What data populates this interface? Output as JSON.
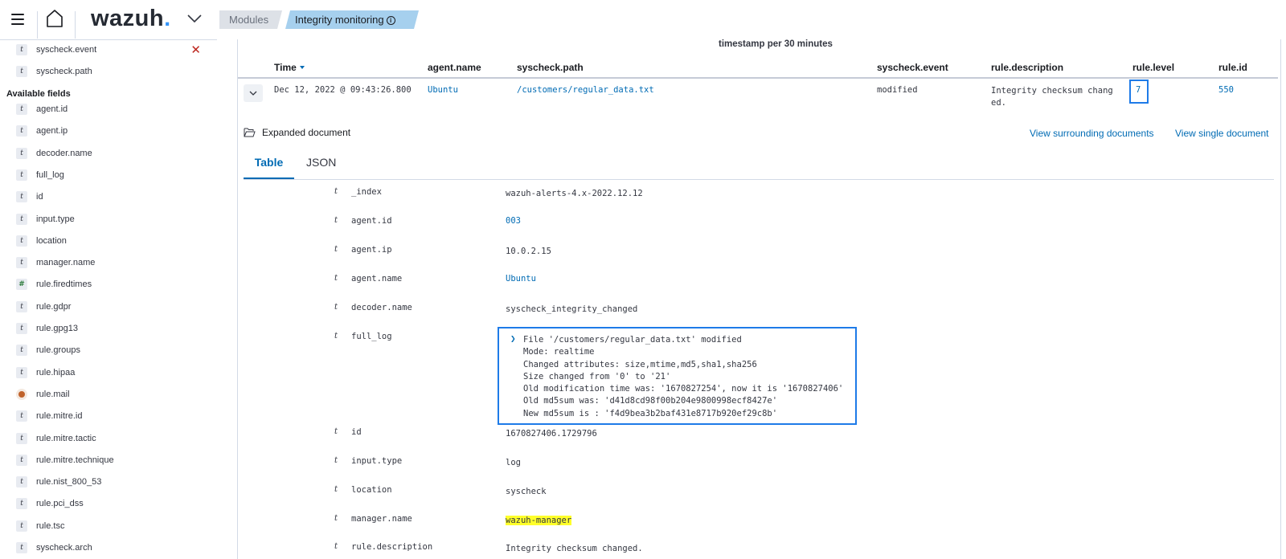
{
  "header": {
    "logo_text": "wazuh",
    "logo_dot": ".",
    "breadcrumb_modules": "Modules",
    "breadcrumb_active": "Integrity monitoring",
    "info_glyph": "i"
  },
  "sidebar": {
    "selected_fields": [
      {
        "type": "t",
        "name": "syscheck.event",
        "removable": true
      },
      {
        "type": "t",
        "name": "syscheck.path"
      }
    ],
    "available_label": "Available fields",
    "available_fields": [
      {
        "type": "t",
        "name": "agent.id"
      },
      {
        "type": "t",
        "name": "agent.ip"
      },
      {
        "type": "t",
        "name": "decoder.name"
      },
      {
        "type": "t",
        "name": "full_log"
      },
      {
        "type": "t",
        "name": "id"
      },
      {
        "type": "t",
        "name": "input.type"
      },
      {
        "type": "t",
        "name": "location"
      },
      {
        "type": "t",
        "name": "manager.name"
      },
      {
        "type": "#",
        "name": "rule.firedtimes"
      },
      {
        "type": "t",
        "name": "rule.gdpr"
      },
      {
        "type": "t",
        "name": "rule.gpg13"
      },
      {
        "type": "t",
        "name": "rule.groups"
      },
      {
        "type": "t",
        "name": "rule.hipaa"
      },
      {
        "type": "geo",
        "name": "rule.mail"
      },
      {
        "type": "t",
        "name": "rule.mitre.id"
      },
      {
        "type": "t",
        "name": "rule.mitre.tactic"
      },
      {
        "type": "t",
        "name": "rule.mitre.technique"
      },
      {
        "type": "t",
        "name": "rule.nist_800_53"
      },
      {
        "type": "t",
        "name": "rule.pci_dss"
      },
      {
        "type": "t",
        "name": "rule.tsc"
      },
      {
        "type": "t",
        "name": "syscheck.arch"
      }
    ]
  },
  "table": {
    "timestamp_label": "timestamp per 30 minutes",
    "columns": {
      "time": "Time",
      "agent_name": "agent.name",
      "path": "syscheck.path",
      "event": "syscheck.event",
      "description": "rule.description",
      "level": "rule.level",
      "id": "rule.id"
    },
    "row": {
      "time": "Dec 12, 2022 @ 09:43:26.800",
      "agent_name": "Ubuntu",
      "path": "/customers/regular_data.txt",
      "event": "modified",
      "description_line1": "Integrity checksum chang",
      "description_line2": "ed.",
      "level": "7",
      "id": "550"
    }
  },
  "expanded": {
    "title": "Expanded document",
    "view_surrounding": "View surrounding documents",
    "view_single": "View single document",
    "tabs": {
      "table": "Table",
      "json": "JSON"
    },
    "fields": {
      "index": {
        "type": "t",
        "key": "_index",
        "value": "wazuh-alerts-4.x-2022.12.12"
      },
      "agent_id": {
        "type": "t",
        "key": "agent.id",
        "value": "003"
      },
      "agent_ip": {
        "type": "t",
        "key": "agent.ip",
        "value": "10.0.2.15"
      },
      "agent_name": {
        "type": "t",
        "key": "agent.name",
        "value": "Ubuntu"
      },
      "decoder_name": {
        "type": "t",
        "key": "decoder.name",
        "value": "syscheck_integrity_changed"
      },
      "full_log": {
        "type": "t",
        "key": "full_log"
      },
      "id": {
        "type": "t",
        "key": "id",
        "value": "1670827406.1729796"
      },
      "input_type": {
        "type": "t",
        "key": "input.type",
        "value": "log"
      },
      "location": {
        "type": "t",
        "key": "location",
        "value": "syscheck"
      },
      "manager_name": {
        "type": "t",
        "key": "manager.name",
        "value": "wazuh-manager"
      },
      "rule_description": {
        "type": "t",
        "key": "rule.description",
        "value": "Integrity checksum changed."
      }
    },
    "full_log_lines": [
      "File '/customers/regular_data.txt' modified",
      "Mode: realtime",
      "Changed attributes: size,mtime,md5,sha1,sha256",
      "Size changed from '0' to '21'",
      "Old modification time was: '1670827254', now it is '1670827406'",
      "Old md5sum was: 'd41d8cd98f00b204e9800998ecf8427e'",
      "New md5sum is : 'f4d9bea3b2baf431e8717b920ef29c8b'"
    ]
  },
  "colors": {
    "accent": "#006bb4",
    "focus_box": "#1e7be8",
    "highlight": "#ffff2a",
    "breadcrumb_active_bg": "#a6d0ee"
  },
  "icons": [
    "menu-icon",
    "home-icon",
    "chevron-down-icon",
    "info-icon",
    "close-icon",
    "folder-open-icon",
    "expand-arrow-icon"
  ]
}
